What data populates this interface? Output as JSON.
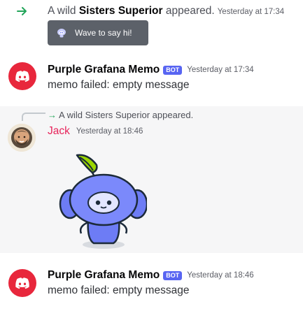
{
  "colors": {
    "join_arrow": "#23a55a",
    "bot_avatar": "#e8273c",
    "bot_tag": "#5865f2",
    "jack_name": "#e7245b",
    "wave_button": "#5c6169",
    "highlight_bg": "#f6f6f7"
  },
  "join": {
    "icon": "arrow-right-icon",
    "prefix": "A wild ",
    "name": "Sisters Superior",
    "suffix": " appeared.",
    "timestamp": "Yesterday at 17:34",
    "wave_button": {
      "icon": "wumpus-sticker-icon",
      "label": "Wave to say hi!"
    }
  },
  "messages": [
    {
      "author": "Purple Grafana Memo",
      "avatar_icon": "discord-bot-avatar",
      "tag": "BOT",
      "timestamp": "Yesterday at 17:34",
      "content": "memo failed: empty message"
    },
    {
      "reply_to": "A wild Sisters Superior appeared.",
      "reply_icon": "arrow-right-icon",
      "author": "Jack",
      "avatar_icon": "user-avatar",
      "timestamp": "Yesterday at 18:46",
      "sticker": "wumpus-wave-sticker"
    },
    {
      "author": "Purple Grafana Memo",
      "avatar_icon": "discord-bot-avatar",
      "tag": "BOT",
      "timestamp": "Yesterday at 18:46",
      "content": "memo failed: empty message"
    }
  ]
}
